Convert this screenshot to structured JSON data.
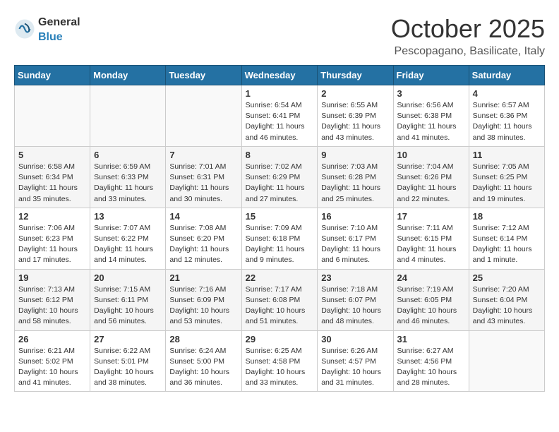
{
  "header": {
    "logo_general": "General",
    "logo_blue": "Blue",
    "month_title": "October 2025",
    "location": "Pescopagano, Basilicate, Italy"
  },
  "weekdays": [
    "Sunday",
    "Monday",
    "Tuesday",
    "Wednesday",
    "Thursday",
    "Friday",
    "Saturday"
  ],
  "weeks": [
    [
      {
        "day": "",
        "info": ""
      },
      {
        "day": "",
        "info": ""
      },
      {
        "day": "",
        "info": ""
      },
      {
        "day": "1",
        "info": "Sunrise: 6:54 AM\nSunset: 6:41 PM\nDaylight: 11 hours and 46 minutes."
      },
      {
        "day": "2",
        "info": "Sunrise: 6:55 AM\nSunset: 6:39 PM\nDaylight: 11 hours and 43 minutes."
      },
      {
        "day": "3",
        "info": "Sunrise: 6:56 AM\nSunset: 6:38 PM\nDaylight: 11 hours and 41 minutes."
      },
      {
        "day": "4",
        "info": "Sunrise: 6:57 AM\nSunset: 6:36 PM\nDaylight: 11 hours and 38 minutes."
      }
    ],
    [
      {
        "day": "5",
        "info": "Sunrise: 6:58 AM\nSunset: 6:34 PM\nDaylight: 11 hours and 35 minutes."
      },
      {
        "day": "6",
        "info": "Sunrise: 6:59 AM\nSunset: 6:33 PM\nDaylight: 11 hours and 33 minutes."
      },
      {
        "day": "7",
        "info": "Sunrise: 7:01 AM\nSunset: 6:31 PM\nDaylight: 11 hours and 30 minutes."
      },
      {
        "day": "8",
        "info": "Sunrise: 7:02 AM\nSunset: 6:29 PM\nDaylight: 11 hours and 27 minutes."
      },
      {
        "day": "9",
        "info": "Sunrise: 7:03 AM\nSunset: 6:28 PM\nDaylight: 11 hours and 25 minutes."
      },
      {
        "day": "10",
        "info": "Sunrise: 7:04 AM\nSunset: 6:26 PM\nDaylight: 11 hours and 22 minutes."
      },
      {
        "day": "11",
        "info": "Sunrise: 7:05 AM\nSunset: 6:25 PM\nDaylight: 11 hours and 19 minutes."
      }
    ],
    [
      {
        "day": "12",
        "info": "Sunrise: 7:06 AM\nSunset: 6:23 PM\nDaylight: 11 hours and 17 minutes."
      },
      {
        "day": "13",
        "info": "Sunrise: 7:07 AM\nSunset: 6:22 PM\nDaylight: 11 hours and 14 minutes."
      },
      {
        "day": "14",
        "info": "Sunrise: 7:08 AM\nSunset: 6:20 PM\nDaylight: 11 hours and 12 minutes."
      },
      {
        "day": "15",
        "info": "Sunrise: 7:09 AM\nSunset: 6:18 PM\nDaylight: 11 hours and 9 minutes."
      },
      {
        "day": "16",
        "info": "Sunrise: 7:10 AM\nSunset: 6:17 PM\nDaylight: 11 hours and 6 minutes."
      },
      {
        "day": "17",
        "info": "Sunrise: 7:11 AM\nSunset: 6:15 PM\nDaylight: 11 hours and 4 minutes."
      },
      {
        "day": "18",
        "info": "Sunrise: 7:12 AM\nSunset: 6:14 PM\nDaylight: 11 hours and 1 minute."
      }
    ],
    [
      {
        "day": "19",
        "info": "Sunrise: 7:13 AM\nSunset: 6:12 PM\nDaylight: 10 hours and 58 minutes."
      },
      {
        "day": "20",
        "info": "Sunrise: 7:15 AM\nSunset: 6:11 PM\nDaylight: 10 hours and 56 minutes."
      },
      {
        "day": "21",
        "info": "Sunrise: 7:16 AM\nSunset: 6:09 PM\nDaylight: 10 hours and 53 minutes."
      },
      {
        "day": "22",
        "info": "Sunrise: 7:17 AM\nSunset: 6:08 PM\nDaylight: 10 hours and 51 minutes."
      },
      {
        "day": "23",
        "info": "Sunrise: 7:18 AM\nSunset: 6:07 PM\nDaylight: 10 hours and 48 minutes."
      },
      {
        "day": "24",
        "info": "Sunrise: 7:19 AM\nSunset: 6:05 PM\nDaylight: 10 hours and 46 minutes."
      },
      {
        "day": "25",
        "info": "Sunrise: 7:20 AM\nSunset: 6:04 PM\nDaylight: 10 hours and 43 minutes."
      }
    ],
    [
      {
        "day": "26",
        "info": "Sunrise: 6:21 AM\nSunset: 5:02 PM\nDaylight: 10 hours and 41 minutes."
      },
      {
        "day": "27",
        "info": "Sunrise: 6:22 AM\nSunset: 5:01 PM\nDaylight: 10 hours and 38 minutes."
      },
      {
        "day": "28",
        "info": "Sunrise: 6:24 AM\nSunset: 5:00 PM\nDaylight: 10 hours and 36 minutes."
      },
      {
        "day": "29",
        "info": "Sunrise: 6:25 AM\nSunset: 4:58 PM\nDaylight: 10 hours and 33 minutes."
      },
      {
        "day": "30",
        "info": "Sunrise: 6:26 AM\nSunset: 4:57 PM\nDaylight: 10 hours and 31 minutes."
      },
      {
        "day": "31",
        "info": "Sunrise: 6:27 AM\nSunset: 4:56 PM\nDaylight: 10 hours and 28 minutes."
      },
      {
        "day": "",
        "info": ""
      }
    ]
  ]
}
